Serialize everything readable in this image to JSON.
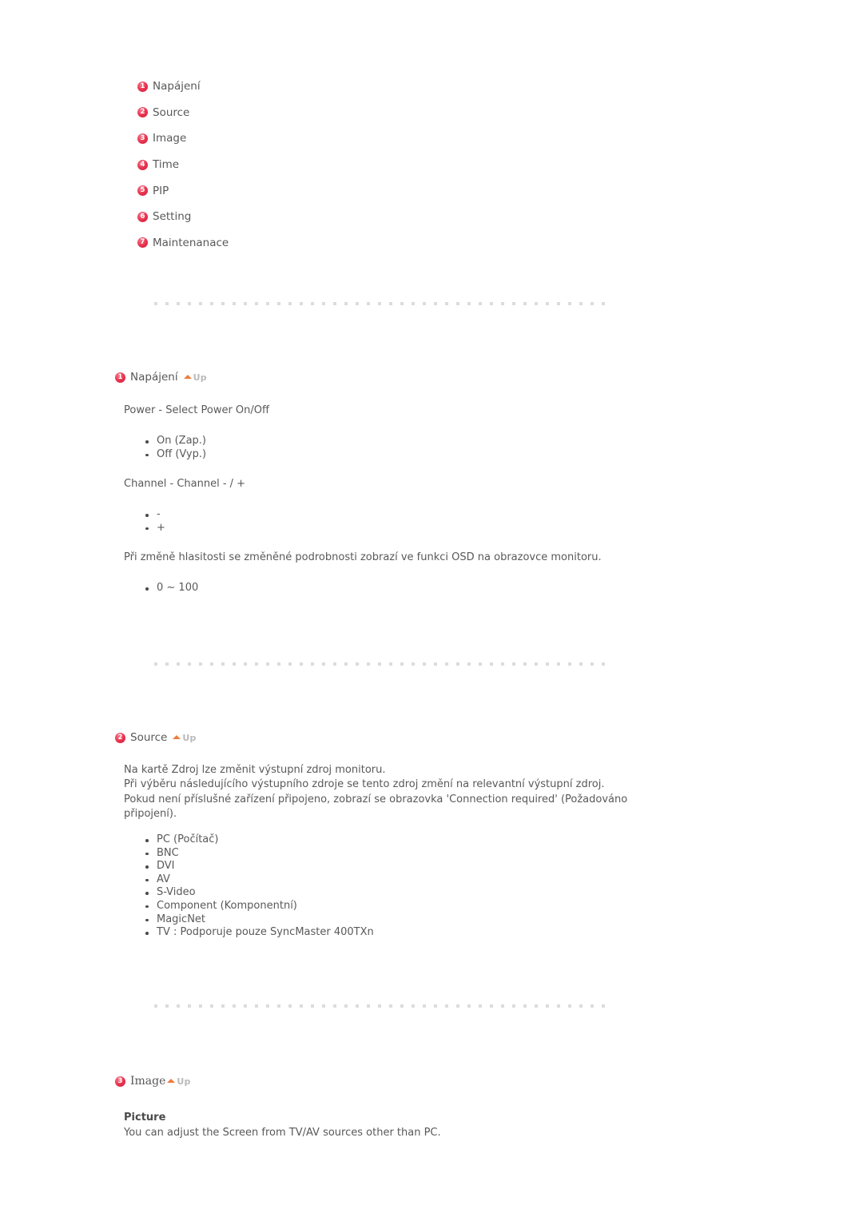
{
  "index": {
    "items": [
      {
        "num": "1",
        "label": "Napájení"
      },
      {
        "num": "2",
        "label": "Source"
      },
      {
        "num": "3",
        "label": "Image"
      },
      {
        "num": "4",
        "label": "Time"
      },
      {
        "num": "5",
        "label": "PIP"
      },
      {
        "num": "6",
        "label": "Setting"
      },
      {
        "num": "7",
        "label": "Maintenanace"
      }
    ]
  },
  "up_link": {
    "label": "Up",
    "arrow_color": "#ef7b3d"
  },
  "sections": {
    "napajeni": {
      "num": "1",
      "title": "Napájení",
      "power_para": "Power - Select Power On/Off",
      "power_items": [
        "On (Zap.)",
        "Off (Vyp.)"
      ],
      "channel_para": "Channel - Channel - / +",
      "channel_items": [
        "-",
        "+"
      ],
      "volume_para": "Při změně hlasitosti se změněné podrobnosti zobrazí ve funkci OSD na obrazovce monitoru.",
      "volume_items": [
        "0 ~ 100"
      ]
    },
    "source": {
      "num": "2",
      "title": "Source",
      "para": "Na kartě Zdroj lze změnit výstupní zdroj monitoru.\nPři výběru následujícího výstupního zdroje se tento zdroj změní na relevantní výstupní zdroj.\nPokud není příslušné zařízení připojeno, zobrazí se obrazovka 'Connection required' (Požadováno připojení).",
      "items": [
        "PC (Počítač)",
        "BNC",
        "DVI",
        "AV",
        "S-Video",
        "Component (Komponentní)",
        "MagicNet",
        "TV : Podporuje pouze SyncMaster 400TXn"
      ]
    },
    "image": {
      "num": "3",
      "title": "Image",
      "picture_heading": "Picture",
      "picture_body": "You can adjust the Screen from TV/AV sources other than PC."
    }
  },
  "colors": {
    "badge_red": "#e8334f",
    "text_gray": "#595959",
    "divider_gray": "#dcdcdc",
    "up_text_gray": "#b9b9b9"
  }
}
